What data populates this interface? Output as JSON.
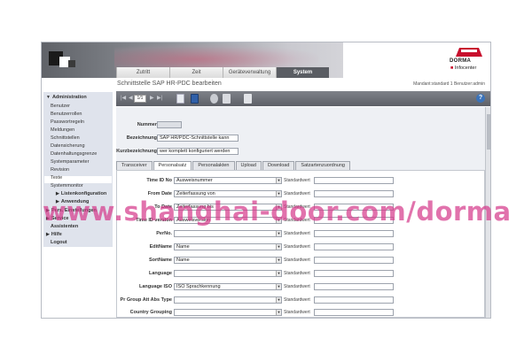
{
  "header": {
    "brand": "DORMA",
    "product": "Infocenter"
  },
  "tabs": [
    "Zutritt",
    "Zeit",
    "Geräteverwaltung",
    "System"
  ],
  "active_tab": "System",
  "subheader": {
    "title": "Schnittstelle SAP HR-PDC bearbeiten",
    "user": "Mandant:standard 1   Benutzer:admin"
  },
  "toolbar": {
    "page": "1/1",
    "nav_first": "|◀",
    "nav_prev": "◀",
    "nav_next": "▶",
    "nav_last": "▶|",
    "help": "?"
  },
  "sidebar": {
    "section_admin": "Administration",
    "items": [
      "Benutzer",
      "Benutzerrollen",
      "Passwortregeln",
      "Meldungen",
      "Schnittstellen",
      "Datensicherung",
      "Datenhaltungsgrenze",
      "Systemparameter",
      "Revision",
      "Texte",
      "Systemmonitor"
    ],
    "sub_items": [
      "Listenkonfiguration",
      "Anwendung"
    ],
    "sections": [
      "Pers. Einstellungen",
      "Service",
      "Assistenten",
      "Hilfe",
      "Logout"
    ]
  },
  "form": {
    "nummer_label": "Nummer",
    "nummer_value": "",
    "bezeichnung_label": "Bezeichnung",
    "bezeichnung_value": "SAP HR/PDC-Schnittstelle kann",
    "kurz_label": "Kurzbezeichnung",
    "kurz_value": "wer komplett konfiguriert werden"
  },
  "subtabs": [
    "Transceiver",
    "Personalsatz",
    "Personalakten",
    "Upload",
    "Download",
    "Satzartenzuordnung"
  ],
  "active_subtab": "Personalsatz",
  "std_label": "Standardwert",
  "fields": [
    {
      "label": "Time ID No",
      "value": "Ausweisnummer"
    },
    {
      "label": "From Date",
      "value": "Zeiterfassung von"
    },
    {
      "label": "To Date",
      "value": "Zeiterfassung bis"
    },
    {
      "label": "Time ID version",
      "value": "Ausweisversion"
    },
    {
      "label": "PerNo.",
      "value": ""
    },
    {
      "label": "EditName",
      "value": "Name"
    },
    {
      "label": "SortName",
      "value": "Name"
    },
    {
      "label": "Language",
      "value": ""
    },
    {
      "label": "Language ISO",
      "value": "ISO Sprachkennung"
    },
    {
      "label": "Pr Group Att Abs Type",
      "value": ""
    },
    {
      "label": "Country Grouping",
      "value": ""
    }
  ],
  "watermark": "www.shanghai-door.com/dorma"
}
